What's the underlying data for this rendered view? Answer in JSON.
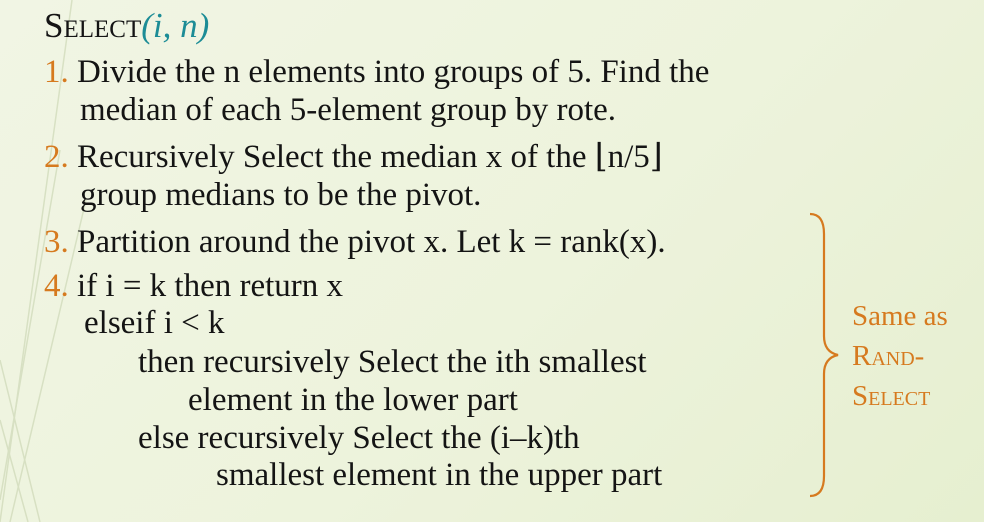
{
  "title": {
    "name": "Select",
    "args": "(i, n)"
  },
  "steps": [
    {
      "number": "1.",
      "line1": "Divide the n elements into groups of 5.  Find the",
      "line2": "median of each 5-element group by rote."
    },
    {
      "number": "2.",
      "line1": "Recursively Select the median x of the ⌊n/5⌋",
      "line2": "group medians to be the pivot."
    },
    {
      "number": "3.",
      "line1": "Partition around the pivot x.  Let k = rank(x)."
    },
    {
      "number": "4.",
      "line1": "if  i = k then return x",
      "line2": "elseif  i < k",
      "line3": "then recursively Select the ith smallest",
      "line4": "element in the lower part",
      "line5": "else  recursively Select the (i–k)th",
      "line6": "smallest element in the upper part"
    }
  ],
  "side_note": {
    "line1": "Same as",
    "line2": "Rand-",
    "line3": "Select"
  },
  "colors": {
    "accent_number": "#d67a1f",
    "math_teal": "#1c8c96",
    "text": "#141414",
    "background": "#eef4df"
  }
}
